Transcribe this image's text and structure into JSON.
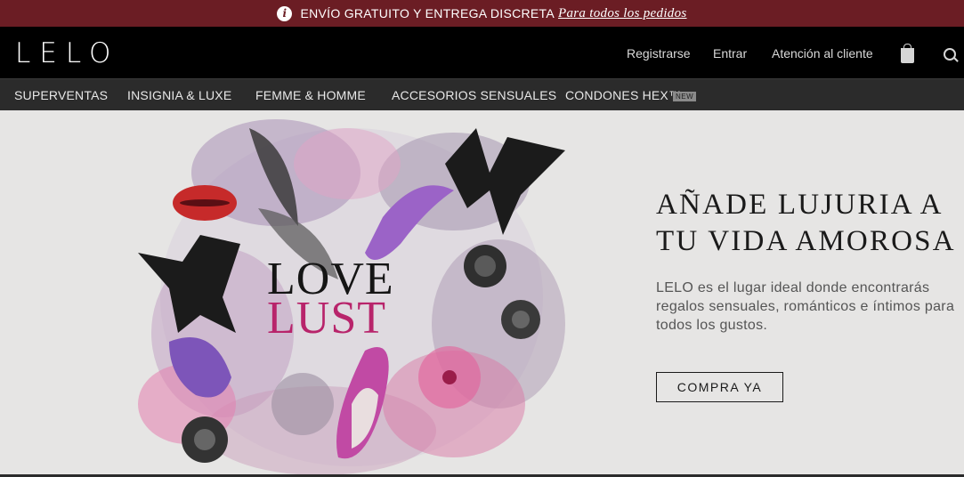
{
  "promo": {
    "text": "ENVÍO GRATUITO Y ENTREGA DISCRETA",
    "link": "Para todos los pedidos",
    "info_icon": "info-icon"
  },
  "header": {
    "logo": "LELO",
    "links": [
      "Registrarse",
      "Entrar",
      "Atención al cliente"
    ],
    "icons": [
      "bag-icon",
      "search-icon"
    ]
  },
  "nav": {
    "items": [
      "SUPERVENTAS",
      "INSIGNIA & LUXE",
      "FEMME & HOMME",
      "ACCESORIOS SENSUALES",
      "CONDONES HEX™"
    ],
    "badge": "NEW"
  },
  "hero": {
    "art_line1": "LOVE",
    "art_line2": "LUST",
    "headline_line1": "AÑADE LUJURIA A",
    "headline_line2": "TU VIDA AMOROSA",
    "description": "LELO es el lugar ideal donde encontrarás regalos sensuales, románticos e íntimos para todos los gustos.",
    "cta": "COMPRA YA",
    "colors": {
      "accent": "#b8246b",
      "promo_bg": "#6b1d24"
    }
  }
}
